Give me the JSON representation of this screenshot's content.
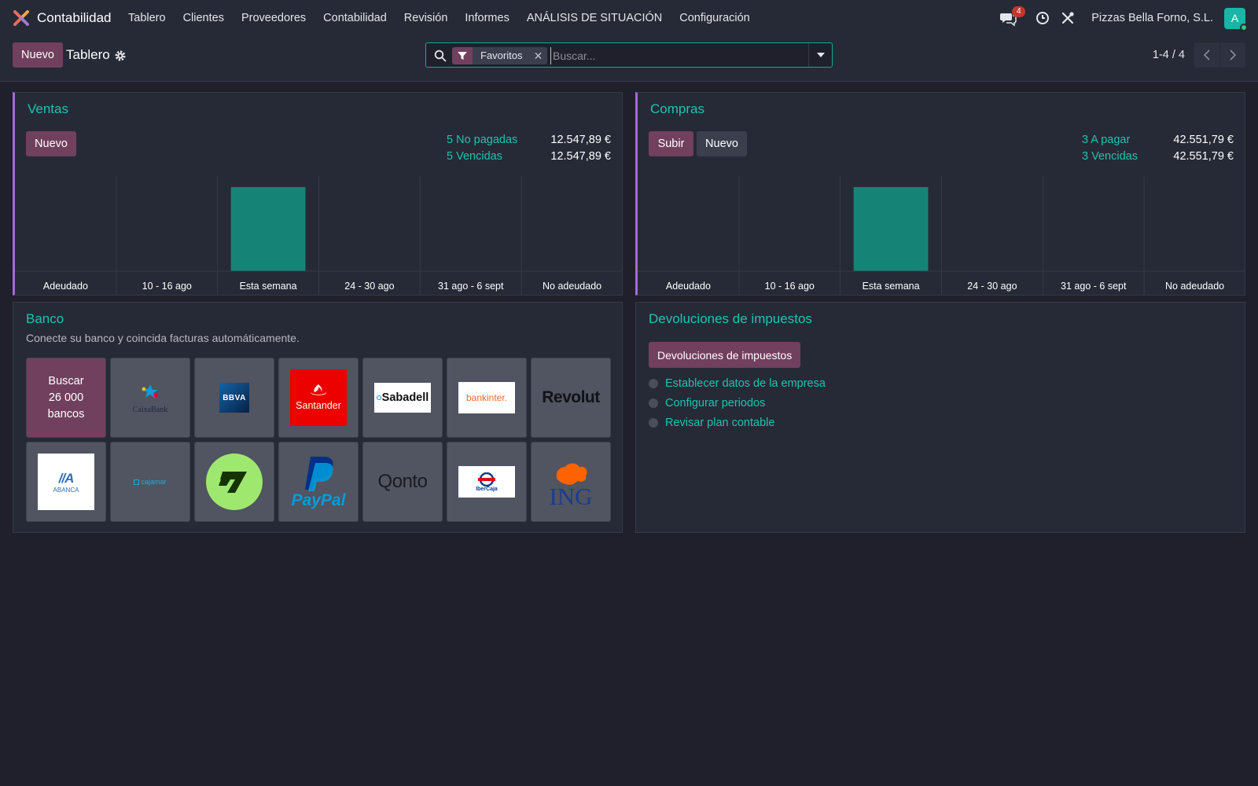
{
  "app": {
    "name": "Contabilidad",
    "logo": "odoo-accounting-logo"
  },
  "nav": {
    "items": [
      "Tablero",
      "Clientes",
      "Proveedores",
      "Contabilidad",
      "Revisión",
      "Informes",
      "ANÁLISIS DE SITUACIÓN",
      "Configuración"
    ],
    "chat_badge": "4",
    "company": "Pizzas Bella Forno, S.L.",
    "avatar_letter": "A"
  },
  "control": {
    "new_label": "Nuevo",
    "title": "Tablero",
    "facet_label": "Favoritos",
    "search_placeholder": "Buscar...",
    "pager": "1-4 / 4"
  },
  "sales": {
    "title": "Ventas",
    "new_label": "Nuevo",
    "stats": [
      {
        "label": "5 No pagadas",
        "value": "12.547,89 €"
      },
      {
        "label": "5 Vencidas",
        "value": "12.547,89 €"
      }
    ]
  },
  "purchases": {
    "title": "Compras",
    "upload_label": "Subir",
    "new_label": "Nuevo",
    "stats": [
      {
        "label": "3 A pagar",
        "value": "42.551,79 €"
      },
      {
        "label": "3 Vencidas",
        "value": "42.551,79 €"
      }
    ]
  },
  "chart_data": [
    {
      "type": "bar",
      "categories": [
        "Adeudado",
        "10 - 16 ago",
        "Esta semana",
        "24 - 30 ago",
        "31 ago - 6 sept",
        "No adeudado"
      ],
      "values": [
        0,
        0,
        12547.89,
        0,
        0,
        0
      ],
      "color": "#168377",
      "title": "",
      "xlabel": "",
      "ylabel": ""
    },
    {
      "type": "bar",
      "categories": [
        "Adeudado",
        "10 - 16 ago",
        "Esta semana",
        "24 - 30 ago",
        "31 ago - 6 sept",
        "No adeudado"
      ],
      "values": [
        0,
        0,
        42551.79,
        0,
        0,
        0
      ],
      "color": "#168377",
      "title": "",
      "xlabel": "",
      "ylabel": ""
    }
  ],
  "bank": {
    "title": "Banco",
    "subtitle": "Conecte su banco y coincida facturas automáticamente.",
    "search_tile": [
      "Buscar",
      "26 000",
      "bancos"
    ],
    "banks": [
      {
        "name": "CaixaBank",
        "icon": "caixabank-logo"
      },
      {
        "name": "BBVA",
        "icon": "bbva-logo"
      },
      {
        "name": "Santander",
        "icon": "santander-logo"
      },
      {
        "name": "Sabadell",
        "icon": "sabadell-logo"
      },
      {
        "name": "bankinter.",
        "icon": "bankinter-logo"
      },
      {
        "name": "Revolut",
        "icon": "revolut-logo"
      },
      {
        "name": "ABANCA",
        "icon": "abanca-logo"
      },
      {
        "name": "cajamar",
        "icon": "cajamar-logo"
      },
      {
        "name": "Wise",
        "icon": "wise-logo"
      },
      {
        "name": "PayPal",
        "icon": "paypal-logo"
      },
      {
        "name": "Qonto",
        "icon": "qonto-logo"
      },
      {
        "name": "IberCaja",
        "icon": "ibercaja-logo"
      },
      {
        "name": "ING",
        "icon": "ing-logo"
      }
    ]
  },
  "tax": {
    "title": "Devoluciones de impuestos",
    "button_label": "Devoluciones de impuestos",
    "steps": [
      "Establecer datos de la empresa",
      "Configurar periodos",
      "Revisar plan contable"
    ]
  },
  "colors": {
    "accent": "#20c2b0",
    "primary": "#71405e",
    "bar": "#168377",
    "background": "#1f202b",
    "card": "#262a36"
  }
}
